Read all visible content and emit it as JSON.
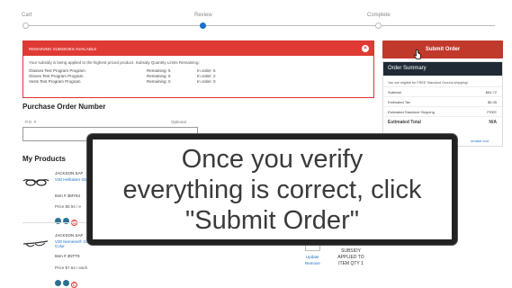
{
  "stepper": {
    "steps": [
      {
        "label": "Cart"
      },
      {
        "label": "Review"
      },
      {
        "label": "Complete"
      }
    ]
  },
  "subsidy": {
    "header": "REMAINING SUBSIDIES AVAILABLE",
    "note": "Your subsidy is being applied to the highest priced product. Subsidy Quantity Limits Remaining:",
    "rows": [
      {
        "program": "Glasses Test Program Program",
        "remaining": "Remaining: 5",
        "in_order": "In order: 5"
      },
      {
        "program": "Gloves Test Program Program",
        "remaining": "Remaining: 6",
        "in_order": "In order: 2"
      },
      {
        "program": "Vests Test Program Program",
        "remaining": "Remaining: 0",
        "in_order": "In order: 0"
      }
    ]
  },
  "po": {
    "title": "Purchase Order Number",
    "label": "P.O. #",
    "optional": "Optional",
    "value": ""
  },
  "products": {
    "title": "My Products",
    "items": [
      {
        "vendor": "JACKSON SAF",
        "name": "V30 Hellraiser Glasses , Clear",
        "item": "Item # 3MY64",
        "price": "Price $8.94 / e",
        "badges": [
          "",
          "",
          "C"
        ]
      },
      {
        "vendor": "JACKSON SAF",
        "name": "V30 Nemesis® Glasses , Clear Lens Color",
        "item": "Item # 3NTT9",
        "price": "Price $7.64 / each",
        "badges": [
          "",
          "",
          "C"
        ]
      }
    ],
    "update": "Update",
    "remove": "Remove",
    "subsidy_status": "SUBSIDY APPLIED TO ITEM QTY 1"
  },
  "right": {
    "submit": "Submit Order",
    "summary_title": "Order Summary",
    "free_note": "You are eligible for FREE Standard Ground shipping!",
    "rows": [
      {
        "k": "Subtotal",
        "v": "$64.72"
      },
      {
        "k": "Estimated Tax",
        "v": "$5.35"
      },
      {
        "k": "Estimated Standard Shipping",
        "v": "FREE"
      }
    ],
    "total_label": "Estimated Total",
    "total_value": "N/A",
    "coupon_fragment": "orndse cod"
  },
  "caption": {
    "text": "Once you verify\neverything is correct, click\n\"Submit Order\""
  },
  "colors": {
    "accent_red": "#c0392b",
    "subsidy_red": "#e03a34",
    "summary_dark": "#1f2a36",
    "link_blue": "#1a6fc4",
    "badge_teal": "#2e6f8e"
  }
}
